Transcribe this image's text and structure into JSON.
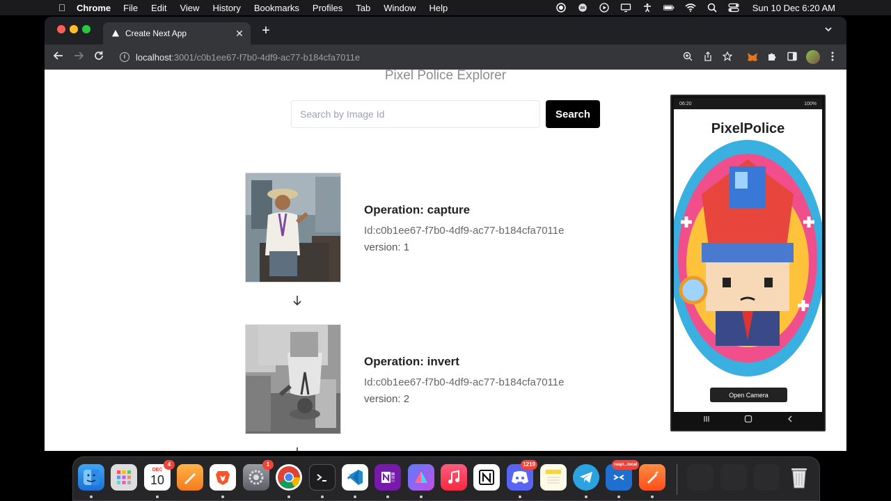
{
  "menubar": {
    "app_name": "Chrome",
    "menus": [
      "File",
      "Edit",
      "View",
      "History",
      "Bookmarks",
      "Profiles",
      "Tab",
      "Window",
      "Help"
    ],
    "datetime": "Sun 10 Dec  6:20 AM",
    "status_badge": "84"
  },
  "browser": {
    "tab_title": "Create Next App",
    "url_host": "localhost",
    "url_path": ":3001/c0b1ee67-f7b0-4df9-ac77-b184cfa7011e"
  },
  "page": {
    "title": "Pixel Police Explorer",
    "search_placeholder": "Search by Image Id",
    "search_button": "Search",
    "entries": [
      {
        "operation": "Operation: capture",
        "id": "Id:c0b1ee67-f7b0-4df9-ac77-b184cfa7011e",
        "version": "version: 1",
        "image": "color"
      },
      {
        "operation": "Operation: invert",
        "id": "Id:c0b1ee67-f7b0-4df9-ac77-b184cfa7011e",
        "version": "version: 2",
        "image": "grayscale"
      }
    ]
  },
  "phone": {
    "status_time": "06:20",
    "status_battery": "100%",
    "app_title": "PixelPolice",
    "button_label": "Open Camera"
  },
  "dock": {
    "calendar_month": "DEC",
    "calendar_day": "10",
    "calendar_badge": "4",
    "settings_badge": "1",
    "discord_badge": "1219",
    "vscode_remote_label": "raspi...local"
  },
  "colors": {
    "accent": "#000000",
    "page_background": "#ffffff"
  }
}
